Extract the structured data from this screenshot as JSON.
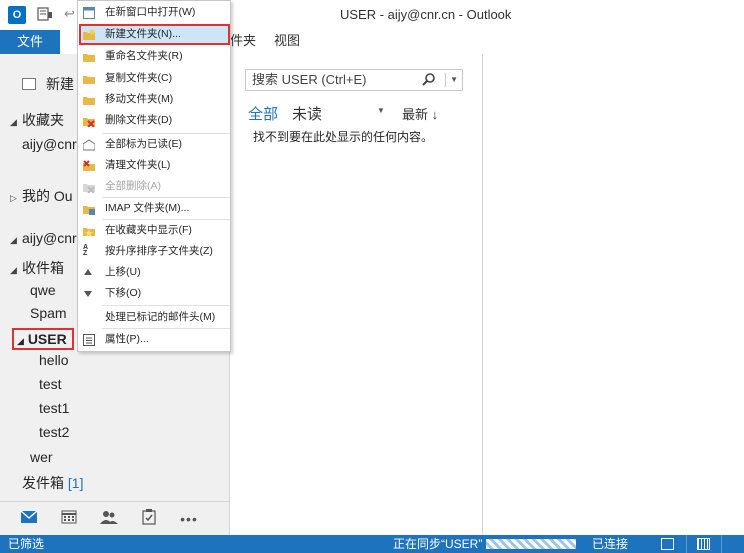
{
  "window": {
    "title": "USER - aijy@cnr.cn - Outlook",
    "app_icon_text": "O"
  },
  "ribbon": {
    "file_tab": "文件",
    "tab_partial": "件夹",
    "tab_view": "视图"
  },
  "nav": {
    "new_email": "新建",
    "favorites": "收藏夹",
    "favorites_account": "aijy@cnr.",
    "my_outlook": "我的 Ou",
    "account": "aijy@cnr",
    "inbox": "收件箱",
    "folders": [
      "qwe",
      "Spam"
    ],
    "user_folder": "USER",
    "user_subfolders": [
      "hello",
      "test",
      "test1",
      "test2"
    ],
    "wer": "wer",
    "sent": "发件箱",
    "sent_count": "[1]"
  },
  "bottom_nav": {
    "icons": [
      "mail-icon",
      "calendar-icon",
      "people-icon",
      "tasks-icon",
      "more-icon"
    ],
    "more": "•••"
  },
  "list": {
    "search_placeholder": "搜索 USER (Ctrl+E)",
    "filter_all": "全部",
    "filter_unread": "未读",
    "sort_label": "最新 ↓",
    "empty": "找不到要在此处显示的任何内容。"
  },
  "context_menu": {
    "items": [
      {
        "label": "在新窗口中打开(W)",
        "icon": "open-window-icon"
      },
      {
        "label": "新建文件夹(N)...",
        "icon": "new-folder-icon"
      },
      {
        "label": "重命名文件夹(R)",
        "icon": "rename-folder-icon"
      },
      {
        "label": "复制文件夹(C)",
        "icon": "copy-folder-icon"
      },
      {
        "label": "移动文件夹(M)",
        "icon": "move-folder-icon"
      },
      {
        "label": "删除文件夹(D)",
        "icon": "delete-folder-icon"
      },
      {
        "label": "全部标为已读(E)",
        "icon": "mark-read-icon"
      },
      {
        "label": "清理文件夹(L)",
        "icon": "clean-folder-icon"
      },
      {
        "label": "全部删除(A)",
        "icon": "delete-all-icon"
      },
      {
        "label": "IMAP 文件夹(M)...",
        "icon": "imap-folder-icon"
      },
      {
        "label": "在收藏夹中显示(F)",
        "icon": "favorite-star-icon"
      },
      {
        "label": "按升序排序子文件夹(Z)",
        "icon": "sort-az-icon"
      },
      {
        "label": "上移(U)",
        "icon": "move-up-icon"
      },
      {
        "label": "下移(O)",
        "icon": "move-down-icon"
      },
      {
        "label": "处理已标记的邮件头(M)",
        "icon": ""
      },
      {
        "label": "属性(P)...",
        "icon": "properties-icon"
      }
    ]
  },
  "status": {
    "filtered": "已筛选",
    "syncing": "正在同步“USER”",
    "connected": "已连接"
  },
  "colors": {
    "accent": "#1e73be",
    "highlight": "#cde6f7",
    "callout_red": "#e03030"
  }
}
